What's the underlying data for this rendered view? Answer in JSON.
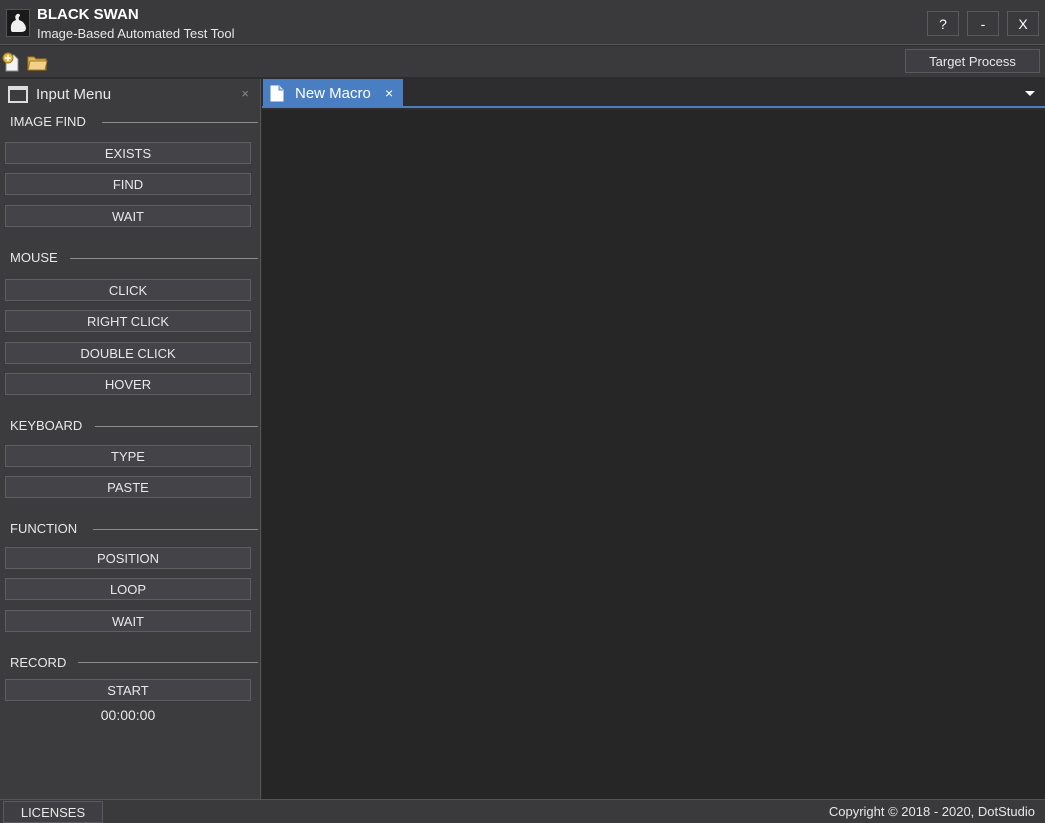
{
  "window": {
    "title": "BLACK SWAN",
    "subtitle": "Image-Based Automated Test Tool",
    "help_label": "?",
    "minimize_label": "-",
    "close_label": "X"
  },
  "toolbar": {
    "target_process_label": "Target Process",
    "icons": [
      "new-file-icon",
      "open-folder-icon"
    ]
  },
  "panel": {
    "title": "Input Menu",
    "close_glyph": "×",
    "sections": {
      "image_find": {
        "label": "IMAGE FIND",
        "buttons": [
          "EXISTS",
          "FIND",
          "WAIT"
        ]
      },
      "mouse": {
        "label": "MOUSE",
        "buttons": [
          "CLICK",
          "RIGHT CLICK",
          "DOUBLE CLICK",
          "HOVER"
        ]
      },
      "keyboard": {
        "label": "KEYBOARD",
        "buttons": [
          "TYPE",
          "PASTE"
        ]
      },
      "function": {
        "label": "FUNCTION",
        "buttons": [
          "POSITION",
          "LOOP",
          "WAIT"
        ]
      },
      "record": {
        "label": "RECORD",
        "buttons": [
          "START"
        ],
        "timer": "00:00:00"
      }
    }
  },
  "editor": {
    "tabs": [
      {
        "label": "New Macro",
        "close_glyph": "×",
        "active": true
      }
    ]
  },
  "statusbar": {
    "licenses_label": "LICENSES",
    "copyright": "Copyright © 2018 - 2020, DotStudio"
  },
  "colors": {
    "accent": "#4a7ec2",
    "background": "#2d2d30",
    "editor_background": "#262626",
    "panel_background": "#3c3c3f"
  }
}
